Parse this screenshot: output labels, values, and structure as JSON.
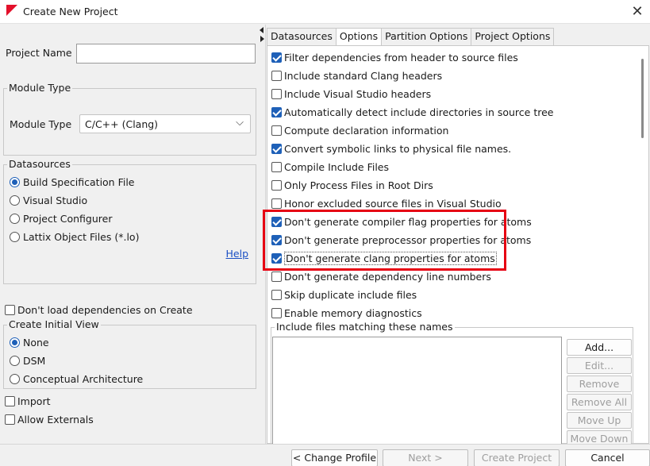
{
  "window": {
    "title": "Create New Project",
    "close_glyph": "✕",
    "app_icon": "red-triangle-logo-icon"
  },
  "project": {
    "name_label": "Project Name",
    "name_value": ""
  },
  "module_type": {
    "group_title": "Module Type",
    "label": "Module Type",
    "selected": "C/C++ (Clang)",
    "chevron": "⌵"
  },
  "datasources": {
    "group_title": "Datasources",
    "options": [
      {
        "label": "Build Specification File",
        "selected": true
      },
      {
        "label": "Visual Studio",
        "selected": false
      },
      {
        "label": "Project Configurer",
        "selected": false
      },
      {
        "label": "Lattix Object Files (*.lo)",
        "selected": false
      }
    ],
    "help_link": "Help"
  },
  "dont_load_deps": {
    "label": "Don't load dependencies on Create",
    "checked": false
  },
  "initial_view": {
    "group_title": "Create Initial View",
    "options": [
      {
        "label": "None",
        "selected": true
      },
      {
        "label": "DSM",
        "selected": false
      },
      {
        "label": "Conceptual Architecture",
        "selected": false
      }
    ]
  },
  "import": {
    "label": "Import",
    "checked": false
  },
  "allow_externals": {
    "label": "Allow Externals",
    "checked": false
  },
  "tabs": [
    {
      "label": "Datasources",
      "active": false
    },
    {
      "label": "Options",
      "active": true
    },
    {
      "label": "Partition Options",
      "active": false
    },
    {
      "label": "Project Options",
      "active": false
    }
  ],
  "options": [
    {
      "label": "Filter dependencies from header to source files",
      "checked": true
    },
    {
      "label": "Include standard Clang headers",
      "checked": false
    },
    {
      "label": "Include Visual Studio headers",
      "checked": false
    },
    {
      "label": "Automatically detect include directories in source tree",
      "checked": true
    },
    {
      "label": "Compute declaration information",
      "checked": false
    },
    {
      "label": "Convert symbolic links to physical file names.",
      "checked": true
    },
    {
      "label": "Compile Include Files",
      "checked": false
    },
    {
      "label": "Only Process Files in Root Dirs",
      "checked": false
    },
    {
      "label": "Honor excluded source files in Visual Studio",
      "checked": false
    },
    {
      "label": "Don't generate compiler flag properties for atoms",
      "checked": true
    },
    {
      "label": "Don't generate preprocessor properties for atoms",
      "checked": true
    },
    {
      "label": "Don't generate clang properties for atoms",
      "checked": true
    },
    {
      "label": "Don't generate dependency line numbers",
      "checked": false
    },
    {
      "label": "Skip duplicate include files",
      "checked": false
    },
    {
      "label": "Enable memory diagnostics",
      "checked": false
    }
  ],
  "include_files": {
    "group_title": "Include files matching these names",
    "buttons": [
      {
        "label": "Add...",
        "enabled": true
      },
      {
        "label": "Edit...",
        "enabled": false
      },
      {
        "label": "Remove",
        "enabled": false
      },
      {
        "label": "Remove All",
        "enabled": false
      },
      {
        "label": "Move Up",
        "enabled": false
      },
      {
        "label": "Move Down",
        "enabled": false
      }
    ]
  },
  "footer": {
    "change_profile": "< Change Profile",
    "next": "Next >",
    "create_project": "Create Project",
    "cancel": "Cancel"
  },
  "highlight_color": "#e60012",
  "accent_color": "#1e60b8"
}
